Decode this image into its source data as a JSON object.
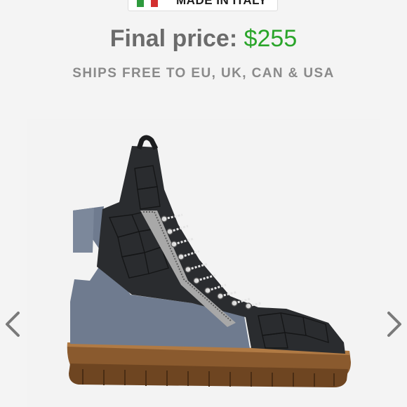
{
  "badge": {
    "text": "MADE IN ITALY",
    "flag_colors": [
      "#2e9a3d",
      "#ffffff",
      "#d32f2f"
    ]
  },
  "price": {
    "label": "Final price:",
    "amount": "$255",
    "amount_color": "#2aa52a"
  },
  "shipping": {
    "text": "SHIPS FREE TO EU, UK, CAN & USA"
  },
  "gallery": {
    "image": "boot-product-icon",
    "prev_icon": "chevron-left-icon",
    "next_icon": "chevron-right-icon"
  }
}
